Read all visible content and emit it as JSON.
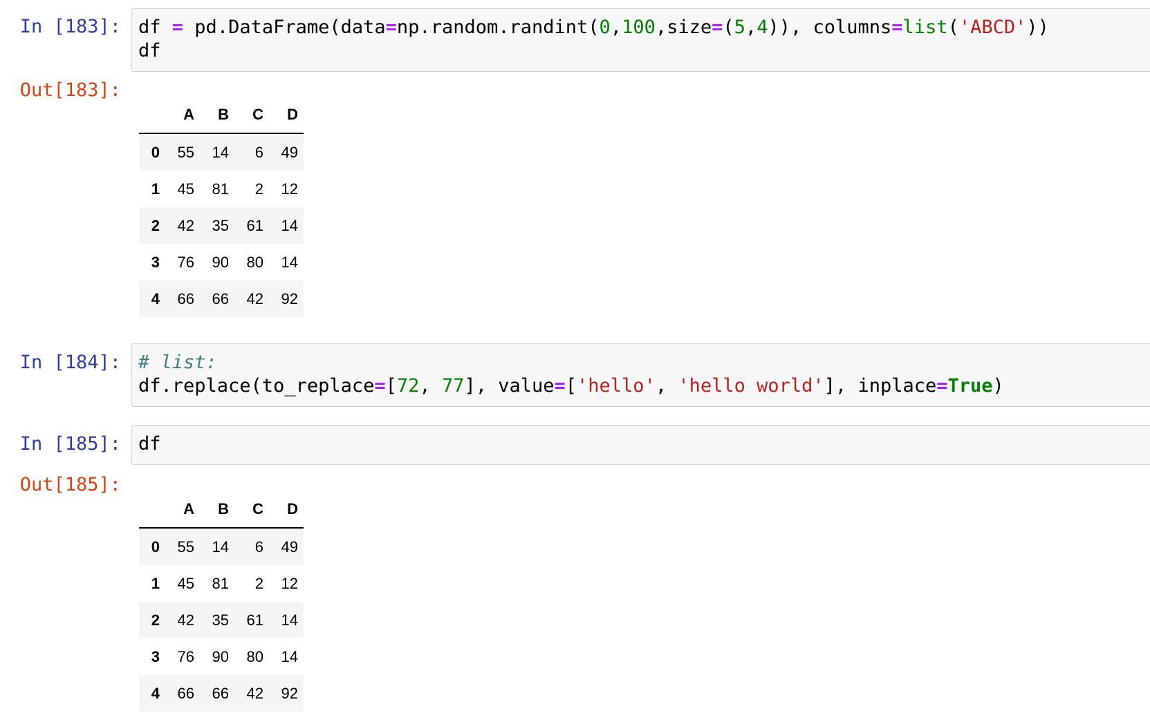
{
  "cells": {
    "c183": {
      "in_prompt": "In [183]:",
      "out_prompt": "Out[183]:",
      "line1": {
        "a": "df ",
        "b": "=",
        "c": " pd.DataFrame(data",
        "d": "=",
        "e": "np.random.randint(",
        "f": "0",
        "g": ",",
        "h": "100",
        "i": ",size",
        "j": "=",
        "k": "(",
        "l": "5",
        "m": ",",
        "n": "4",
        "o": ")), columns",
        "p": "=",
        "q": "list",
        "r": "(",
        "s": "'ABCD'",
        "t": "))"
      },
      "line2": "df"
    },
    "c184": {
      "in_prompt": "In [184]:",
      "line1": "# list:",
      "line2": {
        "a": "df.replace(to_replace",
        "b": "=",
        "c": "[",
        "d": "72",
        "e": ", ",
        "f": "77",
        "g": "], value",
        "h": "=",
        "i": "[",
        "j": "'hello'",
        "k": ", ",
        "l": "'hello world'",
        "m": "], inplace",
        "n": "=",
        "o": "True",
        "p": ")"
      }
    },
    "c185": {
      "in_prompt": "In [185]:",
      "out_prompt": "Out[185]:",
      "line1": "df"
    }
  },
  "table_183": {
    "columns": [
      "A",
      "B",
      "C",
      "D"
    ],
    "rows": [
      {
        "index": "0",
        "values": [
          "55",
          "14",
          "6",
          "49"
        ]
      },
      {
        "index": "1",
        "values": [
          "45",
          "81",
          "2",
          "12"
        ]
      },
      {
        "index": "2",
        "values": [
          "42",
          "35",
          "61",
          "14"
        ]
      },
      {
        "index": "3",
        "values": [
          "76",
          "90",
          "80",
          "14"
        ]
      },
      {
        "index": "4",
        "values": [
          "66",
          "66",
          "42",
          "92"
        ]
      }
    ]
  },
  "table_185": {
    "columns": [
      "A",
      "B",
      "C",
      "D"
    ],
    "rows": [
      {
        "index": "0",
        "values": [
          "55",
          "14",
          "6",
          "49"
        ]
      },
      {
        "index": "1",
        "values": [
          "45",
          "81",
          "2",
          "12"
        ]
      },
      {
        "index": "2",
        "values": [
          "42",
          "35",
          "61",
          "14"
        ]
      },
      {
        "index": "3",
        "values": [
          "76",
          "90",
          "80",
          "14"
        ]
      },
      {
        "index": "4",
        "values": [
          "66",
          "66",
          "42",
          "92"
        ]
      }
    ]
  },
  "colors": {
    "in_prompt": "#303f9f",
    "out_prompt": "#d84315",
    "operator": "#aa22ff",
    "number": "#008000",
    "string": "#ba2121",
    "comment": "#408080",
    "input_bg": "#f7f7f7"
  }
}
